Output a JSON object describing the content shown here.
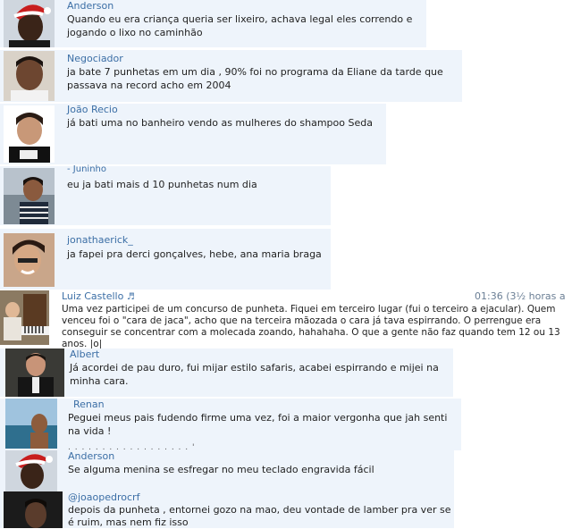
{
  "comments": [
    {
      "author": "Anderson",
      "text": "Quando eu era criança queria ser lixeiro, achava legal eles correndo e jogando o lixo no caminhão",
      "avatar_icon": "user-avatar-santa-hat"
    },
    {
      "author": "Negociador",
      "text": "ja bate 7 punhetas em um dia , 90% foi no programa da Eliane da tarde que passava na record acho em 2004",
      "avatar_icon": "user-avatar"
    },
    {
      "author": "João Recio",
      "text": "já bati uma no banheiro vendo as mulheres do shampoo Seda",
      "avatar_icon": "user-avatar"
    },
    {
      "author": "- Juninho",
      "text": "eu ja bati mais d 10 punhetas num dia",
      "avatar_icon": "user-avatar"
    },
    {
      "author": "jonathaerick_",
      "text": "ja fapei pra derci gonçalves, hebe, ana maria braga",
      "avatar_icon": "user-avatar"
    },
    {
      "author": "Luiz Castello",
      "author_icon": "music-note-icon",
      "author_icon_glyph": "♬",
      "time": "01:36 (3½ horas a",
      "text": "Uma vez participei de um concurso de punheta. Fiquei em terceiro lugar (fui o terceiro a ejacular). Quem venceu foi o \"cara de jaca\", acho que na terceira mãozada o cara já tava espirrando. O perrengue era conseguir se concentrar com a molecada zoando, hahahaha. O que a gente não faz quando tem 12 ou 13 anos. |o|",
      "avatar_icon": "user-avatar-piano"
    },
    {
      "author": "Albert",
      "text": "Já acordei de pau duro, fui mijar estilo safaris, acabei espirrando e mijei na minha cara.",
      "avatar_icon": "user-avatar"
    },
    {
      "author": "Renan",
      "text": "Peguei meus pais fudendo firme uma vez, foi a maior vergonha que jah senti na vida !",
      "avatar_icon": "user-avatar-beach"
    },
    {
      "author": "Anderson",
      "text": "Se alguma menina se esfregar no meu teclado engravida fácil",
      "avatar_icon": "user-avatar-santa-hat"
    },
    {
      "author": "@joaopedrocrf",
      "text": "depois da punheta , entornei gozo na mao, deu vontade de lamber pra ver se é ruim, mas nem fiz isso",
      "avatar_icon": "user-avatar"
    }
  ],
  "colors": {
    "strip_bg": "#eef4fb",
    "name": "#3b6ea5",
    "text": "#222222"
  }
}
